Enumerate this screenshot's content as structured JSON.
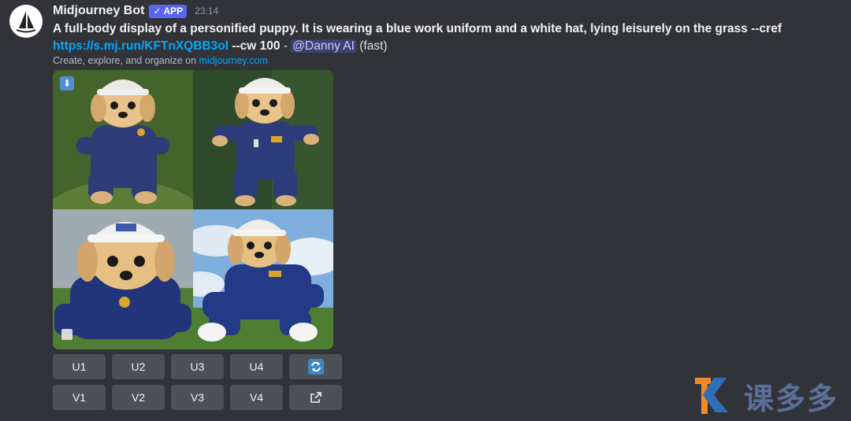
{
  "message": {
    "username": "Midjourney Bot",
    "badge": "APP",
    "time": "23:14",
    "prompt_text": "A full-body display of a personified puppy. It is wearing a blue work uniform and a white hat, lying leisurely on the grass --cref",
    "prompt_link": "https://s.mj.run/KFTnXQBB3ol",
    "prompt_params": "--cw 100",
    "separator": " - ",
    "mention": "@Danny AI",
    "speed": "(fast)",
    "subline_prefix": "Create, explore, and organize on ",
    "subline_site": "midjourney.com"
  },
  "buttons": {
    "u1": "U1",
    "u2": "U2",
    "u3": "U3",
    "u4": "U4",
    "v1": "V1",
    "v2": "V2",
    "v3": "V3",
    "v4": "V4"
  },
  "icons": {
    "download": "download-icon",
    "reroll": "reroll-icon",
    "open": "external-link-icon"
  },
  "colors": {
    "background": "#313338",
    "button": "#4e5058",
    "link": "#00a8fc",
    "badge": "#5865f2"
  },
  "watermark": {
    "text": "课多多"
  }
}
